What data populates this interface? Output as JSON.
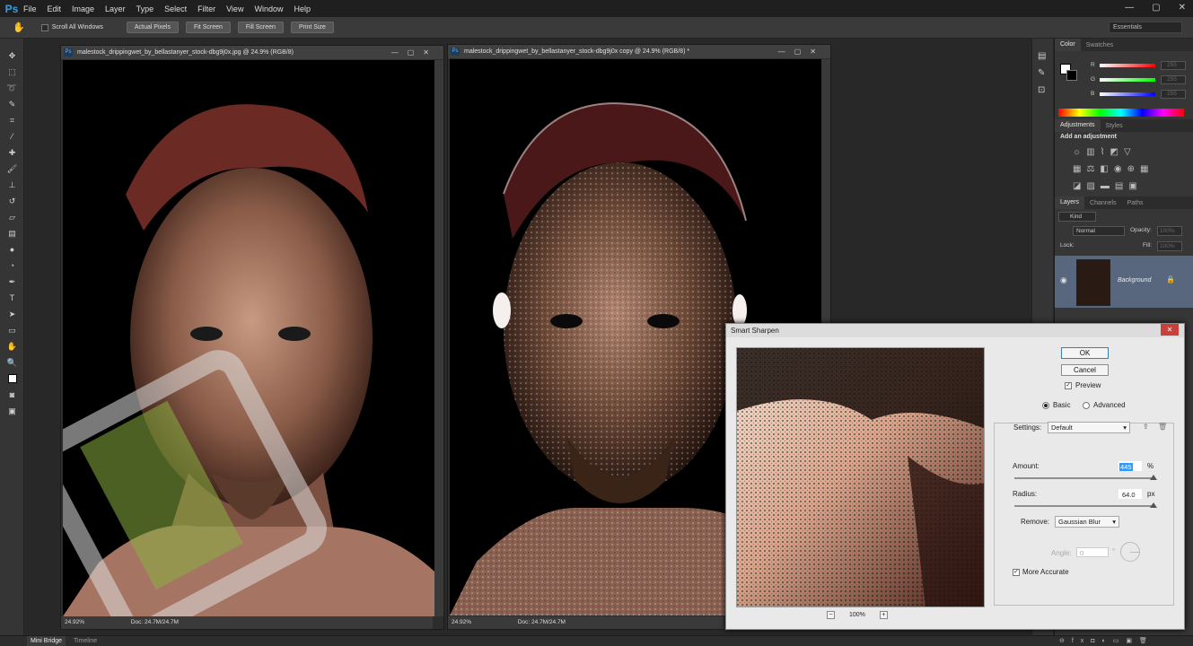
{
  "app": {
    "logo": "Ps"
  },
  "menu": [
    "File",
    "Edit",
    "Image",
    "Layer",
    "Type",
    "Select",
    "Filter",
    "View",
    "Window",
    "Help"
  ],
  "window_controls": {
    "min": "—",
    "max": "▢",
    "close": "✕"
  },
  "options_bar": {
    "scroll_all": "Scroll All Windows",
    "buttons": [
      "Actual Pixels",
      "Fit Screen",
      "Fill Screen",
      "Print Size"
    ],
    "workspace": "Essentials"
  },
  "doc1": {
    "title": "malestock_drippingwet_by_bellastanyer_stock-dbg9j0x.jpg @ 24.9% (RGB/8)",
    "zoom": "24.92%",
    "doc": "Doc: 24.7M/24.7M"
  },
  "doc2": {
    "title": "malestock_drippingwet_by_bellastanyer_stock-dbg9j0x copy @ 24.9% (RGB/8) *",
    "zoom": "24.92%",
    "doc": "Doc: 24.7M/24.7M"
  },
  "panels": {
    "color_tabs": [
      "Color",
      "Swatches"
    ],
    "rgb": [
      {
        "ch": "R",
        "val": "255",
        "color": "#ff0000"
      },
      {
        "ch": "G",
        "val": "255",
        "color": "#00ff00"
      },
      {
        "ch": "B",
        "val": "255",
        "color": "#0000ff"
      }
    ],
    "adj_tabs": [
      "Adjustments",
      "Styles"
    ],
    "adj_title": "Add an adjustment",
    "layers_tabs": [
      "Layers",
      "Channels",
      "Paths"
    ],
    "kind": "Kind",
    "blend": "Normal",
    "opacity_label": "Opacity:",
    "opacity": "100%",
    "lock_label": "Lock:",
    "fill_label": "Fill:",
    "fill": "100%",
    "layer_name": "Background"
  },
  "dialog": {
    "title": "Smart Sharpen",
    "ok": "OK",
    "cancel": "Cancel",
    "preview": "Preview",
    "basic": "Basic",
    "advanced": "Advanced",
    "settings_label": "Settings:",
    "settings_value": "Default",
    "amount_label": "Amount:",
    "amount_value": "445",
    "amount_unit": "%",
    "radius_label": "Radius:",
    "radius_value": "64.0",
    "radius_unit": "px",
    "remove_label": "Remove:",
    "remove_value": "Gaussian Blur",
    "angle_label": "Angle:",
    "angle_value": "0",
    "angle_unit": "°",
    "more_accurate": "More Accurate",
    "zoom": "100%",
    "zoom_out": "−",
    "zoom_in": "+"
  },
  "bottom_tabs": [
    "Mini Bridge",
    "Timeline"
  ]
}
